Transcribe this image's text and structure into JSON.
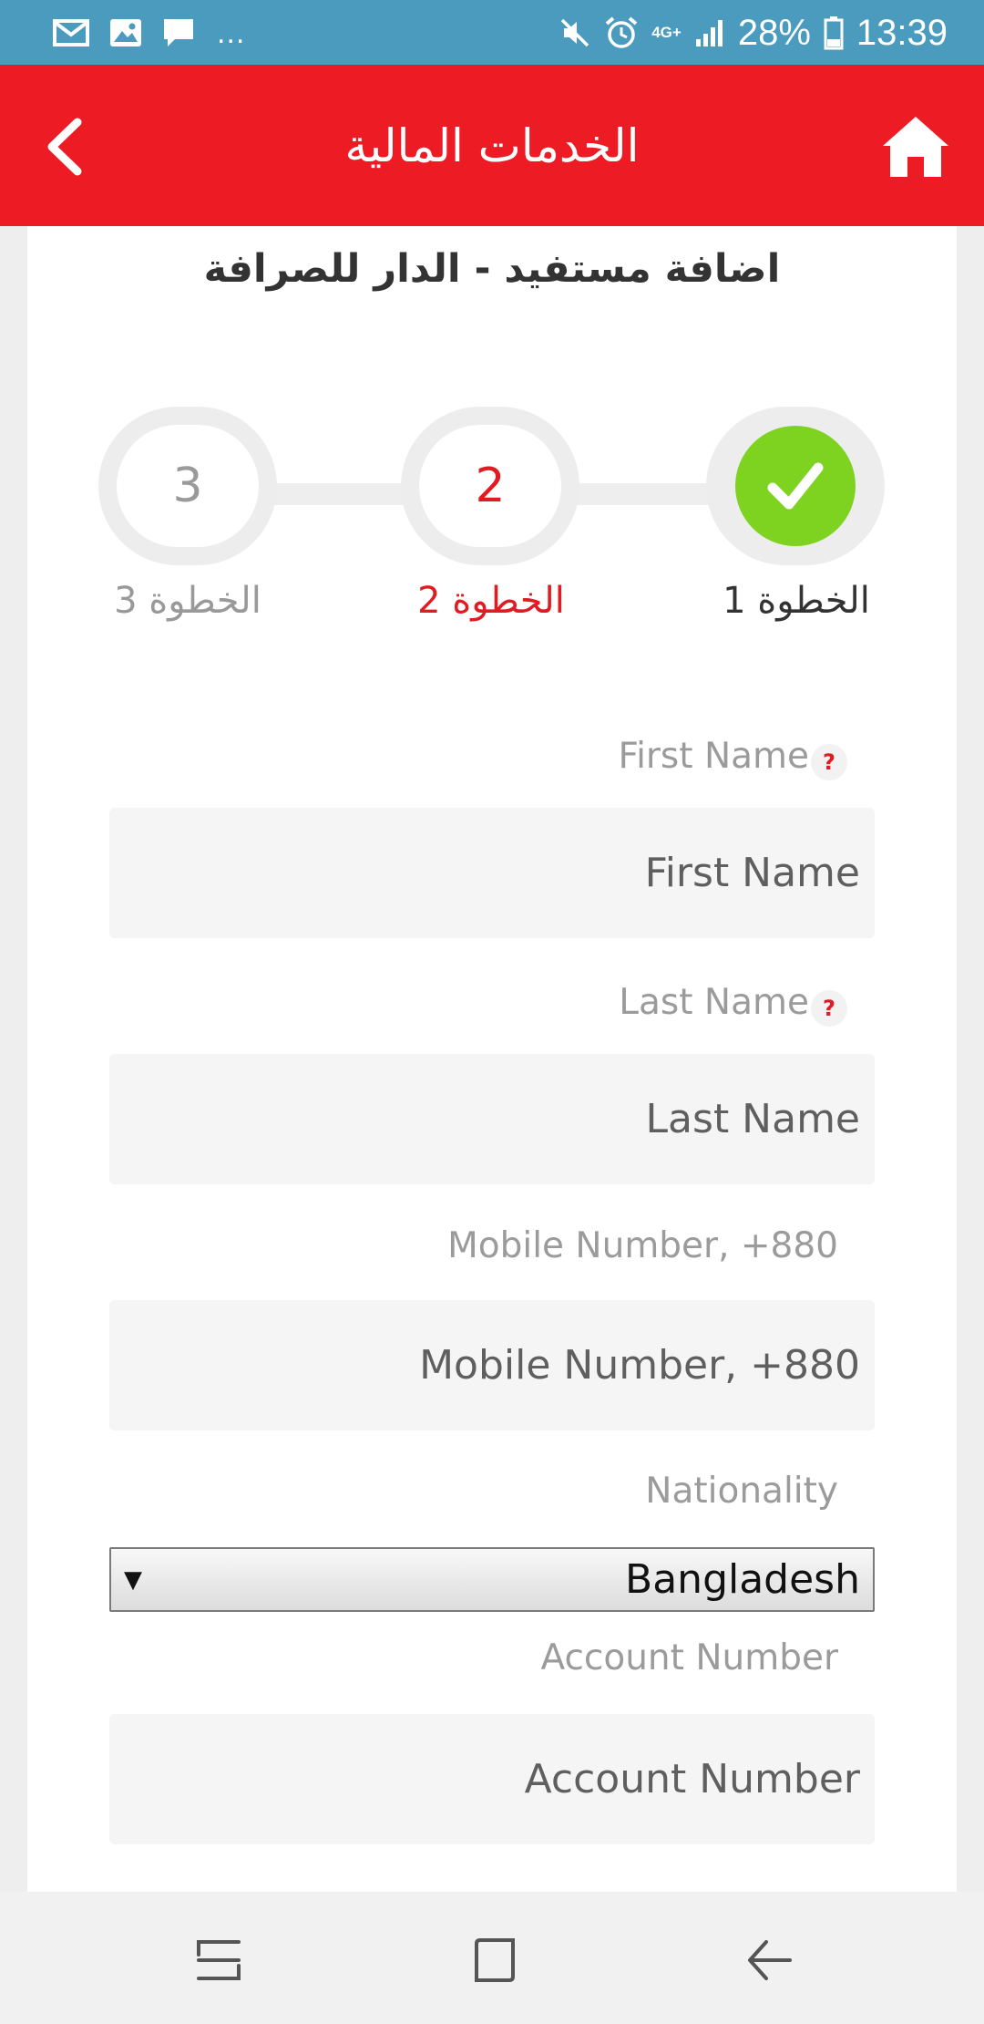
{
  "status_bar": {
    "battery_text": "28%",
    "time": "13:39",
    "network": "4G+",
    "more": "..."
  },
  "app_bar": {
    "title": "الخدمات المالية"
  },
  "page": {
    "title": "اضافة مستفيد - الدار للصرافة"
  },
  "stepper": {
    "steps": [
      {
        "number": "1",
        "label": "الخطوة 1",
        "state": "done"
      },
      {
        "number": "2",
        "label": "الخطوة 2",
        "state": "active"
      },
      {
        "number": "3",
        "label": "الخطوة 3",
        "state": "pending"
      }
    ]
  },
  "form": {
    "first_name": {
      "label": "First Name",
      "placeholder": "First Name",
      "value": ""
    },
    "last_name": {
      "label": "Last Name",
      "placeholder": "Last Name",
      "value": ""
    },
    "mobile": {
      "label": "Mobile Number, +880",
      "placeholder": "Mobile Number, +880",
      "value": ""
    },
    "nationality": {
      "label": "Nationality",
      "selected": "Bangladesh",
      "arrow": "▼"
    },
    "account_number": {
      "label": "Account Number",
      "placeholder": "Account Number",
      "value": ""
    },
    "help_glyph": "?"
  },
  "colors": {
    "status_bar": "#4a9bbd",
    "app_bar": "#ed1c24",
    "step_done": "#7ed321",
    "step_active": "#e01b22"
  },
  "icons": {
    "back": "chevron-left-icon",
    "home": "home-icon",
    "step_done": "check-icon",
    "nav_recent": "recent-apps-icon",
    "nav_home": "nav-home-icon",
    "nav_back": "nav-back-icon"
  }
}
